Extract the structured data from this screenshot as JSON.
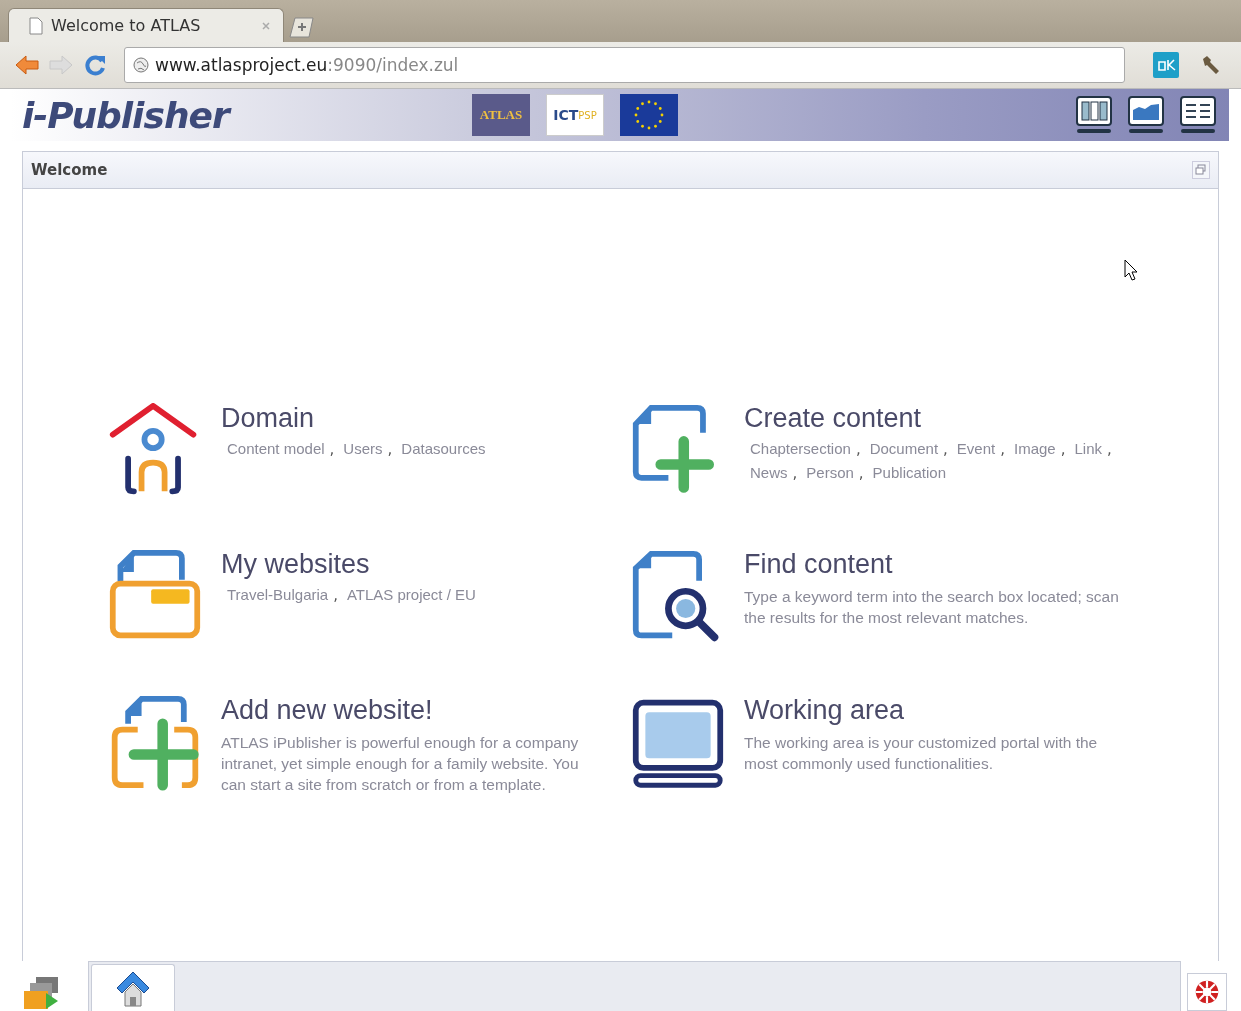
{
  "browser": {
    "tab_title": "Welcome to ATLAS",
    "url_host": "www.atlasproject.eu",
    "url_rest": ":9090/index.zul"
  },
  "header": {
    "app_title": "i-Publisher",
    "logos": [
      "ATLAS",
      "ICT",
      "PSP"
    ]
  },
  "panel": {
    "title": "Welcome"
  },
  "sections": [
    {
      "title": "Domain",
      "kind": "links",
      "separator": ",",
      "links": [
        "Content model",
        "Users",
        "Datasources"
      ]
    },
    {
      "title": "Create content",
      "kind": "links",
      "separator": ",",
      "links": [
        "Chaptersection",
        "Document",
        "Event",
        "Image",
        "Link",
        "News",
        "Person",
        "Publication"
      ]
    },
    {
      "title": "My websites",
      "kind": "links",
      "separator": ",",
      "links": [
        "Travel-Bulgaria",
        "ATLAS project / EU"
      ]
    },
    {
      "title": "Find content",
      "kind": "description",
      "text": "Type a keyword term into the search box located; scan the results for the most relevant matches."
    },
    {
      "title": "Add new website!",
      "kind": "description",
      "text": "ATLAS iPublisher is powerful enough for a company intranet, yet simple enough for a family website. You can start a site from scratch or from a template."
    },
    {
      "title": "Working area",
      "kind": "description",
      "text": "The working area is your customized portal with the most commonly used functionalities."
    }
  ],
  "taskbar": {
    "tabs": [
      {
        "selected": true
      }
    ]
  }
}
